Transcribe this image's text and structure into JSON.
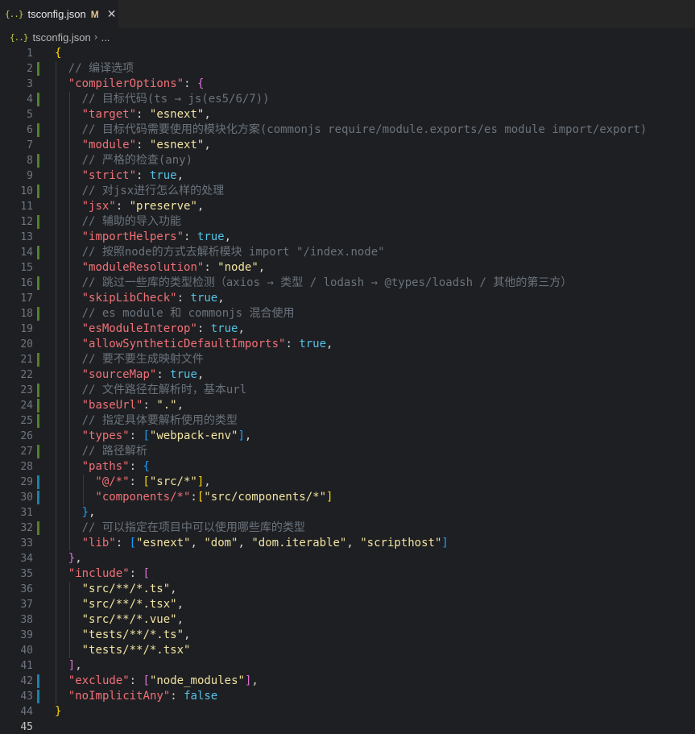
{
  "tab": {
    "icon": "{..}",
    "title": "tsconfig.json",
    "badge": "M",
    "close": "✕"
  },
  "breadcrumb": {
    "icon": "{..}",
    "file": "tsconfig.json",
    "sep": "›",
    "more": "..."
  },
  "line_numbers": [
    "1",
    "2",
    "3",
    "4",
    "5",
    "6",
    "7",
    "8",
    "9",
    "10",
    "11",
    "12",
    "13",
    "14",
    "15",
    "16",
    "17",
    "18",
    "19",
    "20",
    "21",
    "22",
    "23",
    "24",
    "25",
    "26",
    "27",
    "28",
    "29",
    "30",
    "31",
    "32",
    "33",
    "34",
    "35",
    "36",
    "37",
    "38",
    "39",
    "40",
    "41",
    "42",
    "43",
    "44",
    "45"
  ],
  "lines": [
    {
      "indent": 0,
      "git": "",
      "parts": [
        {
          "t": "{",
          "c": "br1"
        }
      ]
    },
    {
      "indent": 1,
      "git": "mod",
      "parts": [
        {
          "t": "// 编译选项",
          "c": "c"
        }
      ]
    },
    {
      "indent": 1,
      "git": "",
      "parts": [
        {
          "t": "\"compilerOptions\"",
          "c": "k"
        },
        {
          "t": ": ",
          "c": "p"
        },
        {
          "t": "{",
          "c": "br2"
        }
      ]
    },
    {
      "indent": 2,
      "git": "mod",
      "parts": [
        {
          "t": "// 目标代码(ts → js(es5/6/7))",
          "c": "c"
        }
      ]
    },
    {
      "indent": 2,
      "git": "",
      "parts": [
        {
          "t": "\"target\"",
          "c": "k"
        },
        {
          "t": ": ",
          "c": "p"
        },
        {
          "t": "\"esnext\"",
          "c": "s"
        },
        {
          "t": ",",
          "c": "p"
        }
      ]
    },
    {
      "indent": 2,
      "git": "mod",
      "parts": [
        {
          "t": "// 目标代码需要使用的模块化方案(commonjs require/module.exports/es module import/export)",
          "c": "c"
        }
      ]
    },
    {
      "indent": 2,
      "git": "",
      "parts": [
        {
          "t": "\"module\"",
          "c": "k"
        },
        {
          "t": ": ",
          "c": "p"
        },
        {
          "t": "\"esnext\"",
          "c": "s"
        },
        {
          "t": ",",
          "c": "p"
        }
      ]
    },
    {
      "indent": 2,
      "git": "mod",
      "parts": [
        {
          "t": "// 严格的检查(any)",
          "c": "c"
        }
      ]
    },
    {
      "indent": 2,
      "git": "",
      "parts": [
        {
          "t": "\"strict\"",
          "c": "k"
        },
        {
          "t": ": ",
          "c": "p"
        },
        {
          "t": "true",
          "c": "b"
        },
        {
          "t": ",",
          "c": "p"
        }
      ]
    },
    {
      "indent": 2,
      "git": "mod",
      "parts": [
        {
          "t": "// 对jsx进行怎么样的处理",
          "c": "c"
        }
      ]
    },
    {
      "indent": 2,
      "git": "",
      "parts": [
        {
          "t": "\"jsx\"",
          "c": "k"
        },
        {
          "t": ": ",
          "c": "p"
        },
        {
          "t": "\"preserve\"",
          "c": "s"
        },
        {
          "t": ",",
          "c": "p"
        }
      ]
    },
    {
      "indent": 2,
      "git": "mod",
      "parts": [
        {
          "t": "// 辅助的导入功能",
          "c": "c"
        }
      ]
    },
    {
      "indent": 2,
      "git": "",
      "parts": [
        {
          "t": "\"importHelpers\"",
          "c": "k"
        },
        {
          "t": ": ",
          "c": "p"
        },
        {
          "t": "true",
          "c": "b"
        },
        {
          "t": ",",
          "c": "p"
        }
      ]
    },
    {
      "indent": 2,
      "git": "mod",
      "parts": [
        {
          "t": "// 按照node的方式去解析模块 import \"/index.node\"",
          "c": "c"
        }
      ]
    },
    {
      "indent": 2,
      "git": "",
      "parts": [
        {
          "t": "\"moduleResolution\"",
          "c": "k"
        },
        {
          "t": ": ",
          "c": "p"
        },
        {
          "t": "\"node\"",
          "c": "s"
        },
        {
          "t": ",",
          "c": "p"
        }
      ]
    },
    {
      "indent": 2,
      "git": "mod",
      "parts": [
        {
          "t": "// 跳过一些库的类型检测（axios → 类型 / lodash → @types/loadsh / 其他的第三方）",
          "c": "c"
        }
      ]
    },
    {
      "indent": 2,
      "git": "",
      "parts": [
        {
          "t": "\"skipLibCheck\"",
          "c": "k"
        },
        {
          "t": ": ",
          "c": "p"
        },
        {
          "t": "true",
          "c": "b"
        },
        {
          "t": ",",
          "c": "p"
        }
      ]
    },
    {
      "indent": 2,
      "git": "mod",
      "parts": [
        {
          "t": "// es module 和 commonjs 混合使用",
          "c": "c"
        }
      ]
    },
    {
      "indent": 2,
      "git": "",
      "parts": [
        {
          "t": "\"esModuleInterop\"",
          "c": "k"
        },
        {
          "t": ": ",
          "c": "p"
        },
        {
          "t": "true",
          "c": "b"
        },
        {
          "t": ",",
          "c": "p"
        }
      ]
    },
    {
      "indent": 2,
      "git": "",
      "parts": [
        {
          "t": "\"allowSyntheticDefaultImports\"",
          "c": "k"
        },
        {
          "t": ": ",
          "c": "p"
        },
        {
          "t": "true",
          "c": "b"
        },
        {
          "t": ",",
          "c": "p"
        }
      ]
    },
    {
      "indent": 2,
      "git": "mod",
      "parts": [
        {
          "t": "// 要不要生成映射文件",
          "c": "c"
        }
      ]
    },
    {
      "indent": 2,
      "git": "",
      "parts": [
        {
          "t": "\"sourceMap\"",
          "c": "k"
        },
        {
          "t": ": ",
          "c": "p"
        },
        {
          "t": "true",
          "c": "b"
        },
        {
          "t": ",",
          "c": "p"
        }
      ]
    },
    {
      "indent": 2,
      "git": "mod",
      "parts": [
        {
          "t": "// 文件路径在解析时，基本url",
          "c": "c"
        }
      ]
    },
    {
      "indent": 2,
      "git": "mod",
      "parts": [
        {
          "t": "\"baseUrl\"",
          "c": "k"
        },
        {
          "t": ": ",
          "c": "p"
        },
        {
          "t": "\".\"",
          "c": "s"
        },
        {
          "t": ",",
          "c": "p"
        }
      ]
    },
    {
      "indent": 2,
      "git": "mod",
      "parts": [
        {
          "t": "// 指定具体要解析使用的类型",
          "c": "c"
        }
      ]
    },
    {
      "indent": 2,
      "git": "",
      "parts": [
        {
          "t": "\"types\"",
          "c": "k"
        },
        {
          "t": ": ",
          "c": "p"
        },
        {
          "t": "[",
          "c": "br3"
        },
        {
          "t": "\"webpack-env\"",
          "c": "s"
        },
        {
          "t": "]",
          "c": "br3"
        },
        {
          "t": ",",
          "c": "p"
        }
      ]
    },
    {
      "indent": 2,
      "git": "mod",
      "parts": [
        {
          "t": "// 路径解析",
          "c": "c"
        }
      ]
    },
    {
      "indent": 2,
      "git": "",
      "parts": [
        {
          "t": "\"paths\"",
          "c": "k"
        },
        {
          "t": ": ",
          "c": "p"
        },
        {
          "t": "{",
          "c": "br3"
        }
      ]
    },
    {
      "indent": 3,
      "git": "add",
      "parts": [
        {
          "t": "\"@/*\"",
          "c": "k"
        },
        {
          "t": ": ",
          "c": "p"
        },
        {
          "t": "[",
          "c": "br1"
        },
        {
          "t": "\"src/*\"",
          "c": "s"
        },
        {
          "t": "]",
          "c": "br1"
        },
        {
          "t": ",",
          "c": "p"
        }
      ]
    },
    {
      "indent": 3,
      "git": "add",
      "parts": [
        {
          "t": "\"components/*\"",
          "c": "k"
        },
        {
          "t": ":",
          "c": "p"
        },
        {
          "t": "[",
          "c": "br1"
        },
        {
          "t": "\"src/components/*\"",
          "c": "s"
        },
        {
          "t": "]",
          "c": "br1"
        }
      ]
    },
    {
      "indent": 2,
      "git": "",
      "parts": [
        {
          "t": "}",
          "c": "br3"
        },
        {
          "t": ",",
          "c": "p"
        }
      ]
    },
    {
      "indent": 2,
      "git": "mod",
      "parts": [
        {
          "t": "// 可以指定在项目中可以使用哪些库的类型",
          "c": "c"
        }
      ]
    },
    {
      "indent": 2,
      "git": "",
      "parts": [
        {
          "t": "\"lib\"",
          "c": "k"
        },
        {
          "t": ": ",
          "c": "p"
        },
        {
          "t": "[",
          "c": "br3"
        },
        {
          "t": "\"esnext\"",
          "c": "s"
        },
        {
          "t": ", ",
          "c": "p"
        },
        {
          "t": "\"dom\"",
          "c": "s"
        },
        {
          "t": ", ",
          "c": "p"
        },
        {
          "t": "\"dom.iterable\"",
          "c": "s"
        },
        {
          "t": ", ",
          "c": "p"
        },
        {
          "t": "\"scripthost\"",
          "c": "s"
        },
        {
          "t": "]",
          "c": "br3"
        }
      ]
    },
    {
      "indent": 1,
      "git": "",
      "parts": [
        {
          "t": "}",
          "c": "br2"
        },
        {
          "t": ",",
          "c": "p"
        }
      ]
    },
    {
      "indent": 1,
      "git": "",
      "parts": [
        {
          "t": "\"include\"",
          "c": "k"
        },
        {
          "t": ": ",
          "c": "p"
        },
        {
          "t": "[",
          "c": "br2"
        }
      ]
    },
    {
      "indent": 2,
      "git": "",
      "parts": [
        {
          "t": "\"src/**/*.ts\"",
          "c": "s"
        },
        {
          "t": ",",
          "c": "p"
        }
      ]
    },
    {
      "indent": 2,
      "git": "",
      "parts": [
        {
          "t": "\"src/**/*.tsx\"",
          "c": "s"
        },
        {
          "t": ",",
          "c": "p"
        }
      ]
    },
    {
      "indent": 2,
      "git": "",
      "parts": [
        {
          "t": "\"src/**/*.vue\"",
          "c": "s"
        },
        {
          "t": ",",
          "c": "p"
        }
      ]
    },
    {
      "indent": 2,
      "git": "",
      "parts": [
        {
          "t": "\"tests/**/*.ts\"",
          "c": "s"
        },
        {
          "t": ",",
          "c": "p"
        }
      ]
    },
    {
      "indent": 2,
      "git": "",
      "parts": [
        {
          "t": "\"tests/**/*.tsx\"",
          "c": "s"
        }
      ]
    },
    {
      "indent": 1,
      "git": "",
      "parts": [
        {
          "t": "]",
          "c": "br2"
        },
        {
          "t": ",",
          "c": "p"
        }
      ]
    },
    {
      "indent": 1,
      "git": "add",
      "parts": [
        {
          "t": "\"exclude\"",
          "c": "k"
        },
        {
          "t": ": ",
          "c": "p"
        },
        {
          "t": "[",
          "c": "br2"
        },
        {
          "t": "\"node_modules\"",
          "c": "s"
        },
        {
          "t": "]",
          "c": "br2"
        },
        {
          "t": ",",
          "c": "p"
        }
      ]
    },
    {
      "indent": 1,
      "git": "add",
      "parts": [
        {
          "t": "\"noImplicitAny\"",
          "c": "k"
        },
        {
          "t": ": ",
          "c": "p"
        },
        {
          "t": "false",
          "c": "b"
        }
      ]
    },
    {
      "indent": 0,
      "git": "",
      "parts": [
        {
          "t": "}",
          "c": "br1"
        }
      ]
    },
    {
      "indent": 0,
      "git": "",
      "parts": []
    }
  ],
  "colors": {
    "editor_bg": "#1e1f22",
    "key": "#f07178",
    "string": "#f1e3a1",
    "boolean": "#56c2e6",
    "comment": "#6a737d",
    "git_modified": "#52802c",
    "git_added": "#1b81a8"
  }
}
